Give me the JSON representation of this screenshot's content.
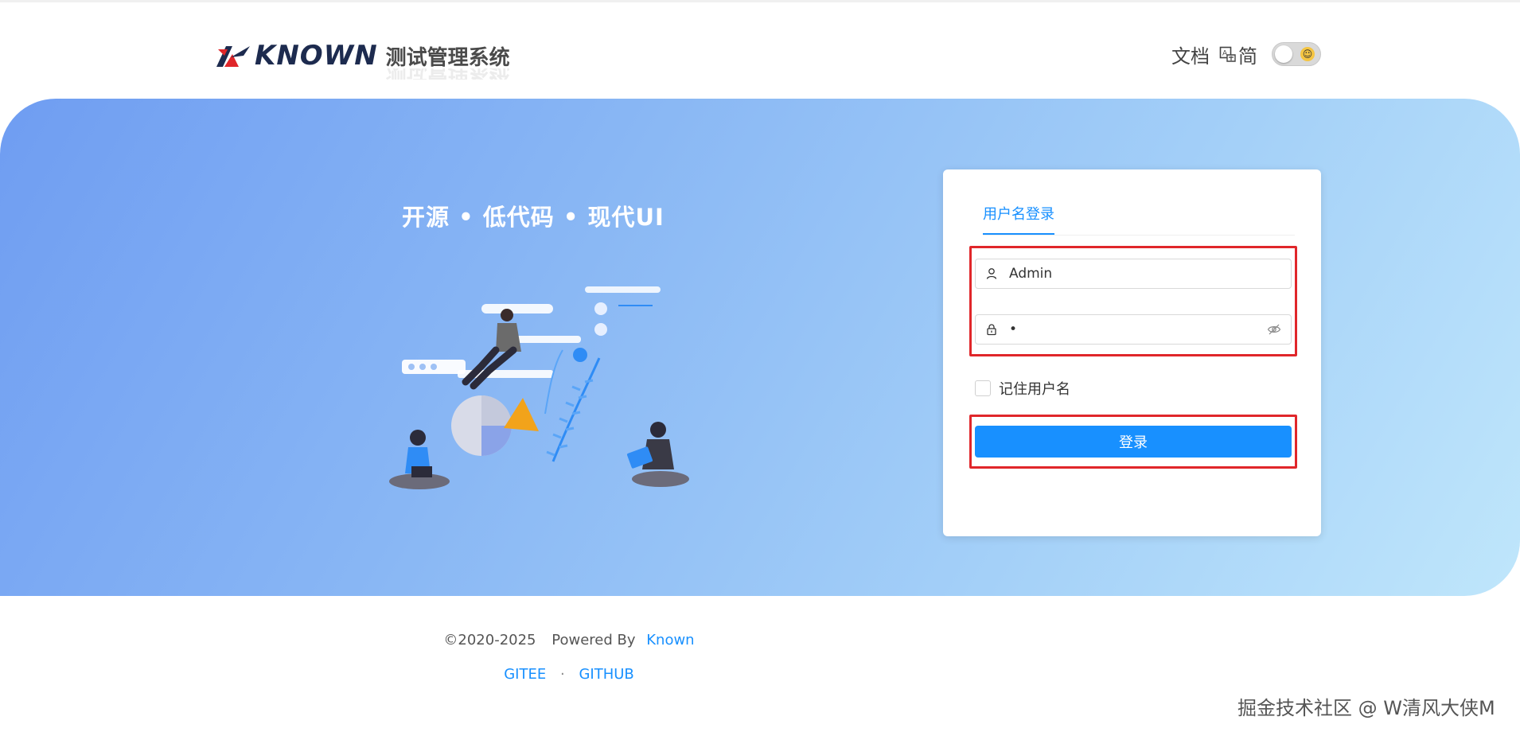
{
  "header": {
    "logo_word": "KNOWN",
    "logo_title": "测试管理系统",
    "docs_label": "文档",
    "lang_label": "简",
    "toggle_emoji": "☺"
  },
  "hero": {
    "slogan": "开源 • 低代码 • 现代UI"
  },
  "login": {
    "tab_label": "用户名登录",
    "username_value": "Admin",
    "password_value": "•",
    "remember_label": "记住用户名",
    "submit_label": "登录"
  },
  "footer": {
    "copyright": "©2020-2025",
    "powered_by": "Powered By",
    "brand": "Known",
    "link_gitee": "GITEE",
    "separator": "·",
    "link_github": "GITHUB"
  },
  "watermark": "掘金技术社区 @ W清风大侠M",
  "colors": {
    "primary": "#1890ff",
    "highlight": "#e0262a",
    "hero_start": "#6f9df2",
    "hero_end": "#bfe6fb"
  },
  "icons": {
    "user": "user-icon",
    "lock": "lock-icon",
    "eye": "eye-off-icon",
    "lang": "translate-icon"
  }
}
